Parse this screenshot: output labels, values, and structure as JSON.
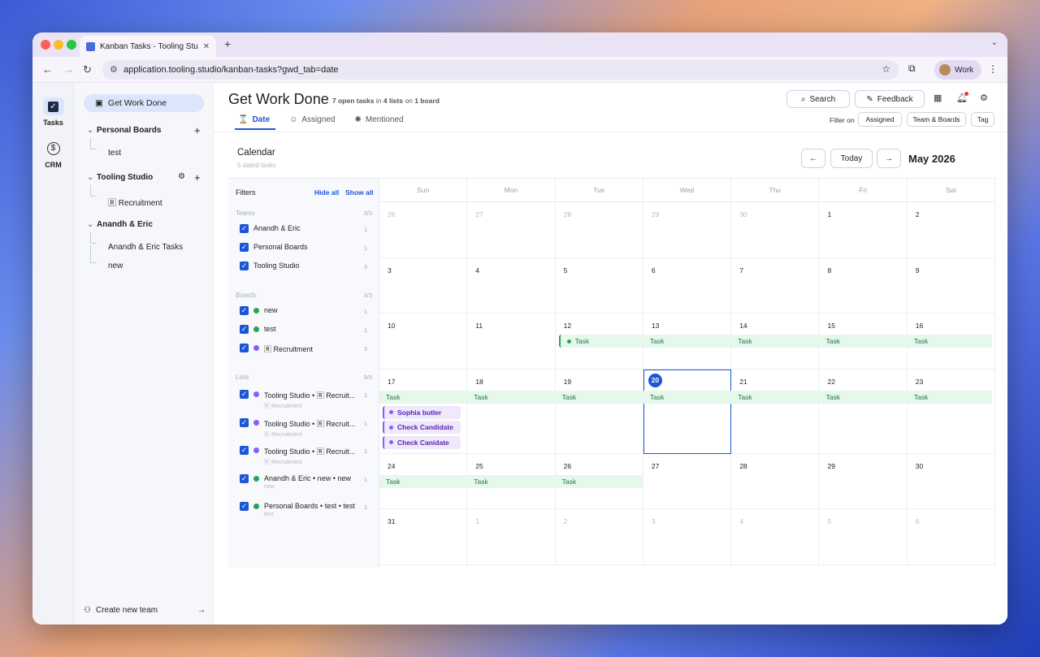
{
  "browser": {
    "tab_title": "Kanban Tasks - Tooling Studio",
    "new_tab": "+",
    "url": "application.tooling.studio/kanban-tasks?gwd_tab=date",
    "profile": "Work",
    "dots": [
      "#ff5f57",
      "#febc2e",
      "#28c840"
    ]
  },
  "rail": [
    {
      "label": "Tasks",
      "icon": "check-square-icon"
    },
    {
      "label": "CRM",
      "icon": "dollar-icon"
    }
  ],
  "sidebar": {
    "get_work_done": "Get Work Done",
    "teams": [
      {
        "name": "Personal Boards",
        "items": [
          "test"
        ]
      },
      {
        "name": "Tooling Studio",
        "items": [
          "🅁 Recruitment"
        ]
      },
      {
        "name": "Anandh & Eric",
        "items": [
          "Anandh & Eric Tasks",
          "new"
        ]
      }
    ],
    "create_team": "Create new team"
  },
  "header": {
    "title": "Get Work Done",
    "meta": {
      "n": "7 open tasks",
      "in": "in",
      "lists": "4 lists",
      "on": "on",
      "board": "1 board"
    },
    "tabs": [
      "Date",
      "Assigned",
      "Mentioned"
    ],
    "search": "Search",
    "feedback": "Feedback",
    "filter_on": "Filter on",
    "chips": [
      "Assigned",
      "Team & Boards",
      "Tag"
    ]
  },
  "calendar": {
    "title": "Calendar",
    "subtitle": "5 dated tasks",
    "today": "Today",
    "month": "May 2026",
    "weekdays": [
      "Sun",
      "Mon",
      "Tue",
      "Wed",
      "Thu",
      "Fri",
      "Sat"
    ],
    "weeks": [
      [
        {
          "d": "26",
          "m": true
        },
        {
          "d": "27",
          "m": true
        },
        {
          "d": "28",
          "m": true
        },
        {
          "d": "29",
          "m": true
        },
        {
          "d": "30",
          "m": true
        },
        {
          "d": "1"
        },
        {
          "d": "2"
        }
      ],
      [
        {
          "d": "3"
        },
        {
          "d": "4"
        },
        {
          "d": "5"
        },
        {
          "d": "6"
        },
        {
          "d": "7"
        },
        {
          "d": "8"
        },
        {
          "d": "9"
        }
      ],
      [
        {
          "d": "10"
        },
        {
          "d": "11"
        },
        {
          "d": "12"
        },
        {
          "d": "13"
        },
        {
          "d": "14"
        },
        {
          "d": "15"
        },
        {
          "d": "16"
        }
      ],
      [
        {
          "d": "17"
        },
        {
          "d": "18"
        },
        {
          "d": "19"
        },
        {
          "d": "20",
          "today": true
        },
        {
          "d": "21"
        },
        {
          "d": "22"
        },
        {
          "d": "23"
        }
      ],
      [
        {
          "d": "24"
        },
        {
          "d": "25"
        },
        {
          "d": "26"
        },
        {
          "d": "27"
        },
        {
          "d": "28"
        },
        {
          "d": "29"
        },
        {
          "d": "30"
        }
      ],
      [
        {
          "d": "31"
        },
        {
          "d": "1",
          "m": true
        },
        {
          "d": "2",
          "m": true
        },
        {
          "d": "3",
          "m": true
        },
        {
          "d": "4",
          "m": true
        },
        {
          "d": "5",
          "m": true
        },
        {
          "d": "6",
          "m": true
        }
      ]
    ],
    "task_label": "Task",
    "purple_tasks": [
      "Sophia butler",
      "Check Candidate",
      "Check Canidate"
    ]
  },
  "filters": {
    "title": "Filters",
    "hide_all": "Hide all",
    "show_all": "Show all",
    "teams": {
      "label": "Teams",
      "count": "3/3",
      "items": [
        {
          "name": "Anandh & Eric",
          "count": "1"
        },
        {
          "name": "Personal Boards",
          "count": "1"
        },
        {
          "name": "Tooling Studio",
          "count": "3"
        }
      ]
    },
    "boards": {
      "label": "Boards",
      "count": "3/3",
      "items": [
        {
          "name": "new",
          "count": "1",
          "color": "#22a55a"
        },
        {
          "name": "test",
          "count": "1",
          "color": "#22a55a"
        },
        {
          "name": "🅁 Recruitment",
          "count": "3",
          "color": "#8b5cf6"
        }
      ]
    },
    "lists": {
      "label": "Lists",
      "count": "5/5",
      "items": [
        {
          "name": "Tooling Studio • 🅁 Recruit...",
          "sub": "🅁 Recruitment",
          "count": "1",
          "color": "#8b5cf6"
        },
        {
          "name": "Tooling Studio • 🅁 Recruit...",
          "sub": "🅁 Recruitment",
          "count": "1",
          "color": "#8b5cf6"
        },
        {
          "name": "Tooling Studio • 🅁 Recruit...",
          "sub": "🅁 Recruitment",
          "count": "1",
          "color": "#8b5cf6"
        },
        {
          "name": "Anandh & Eric • new • new",
          "sub": "new",
          "count": "1",
          "color": "#22a55a"
        },
        {
          "name": "Personal Boards • test • test",
          "sub": "test",
          "count": "1",
          "color": "#22a55a"
        }
      ]
    }
  }
}
